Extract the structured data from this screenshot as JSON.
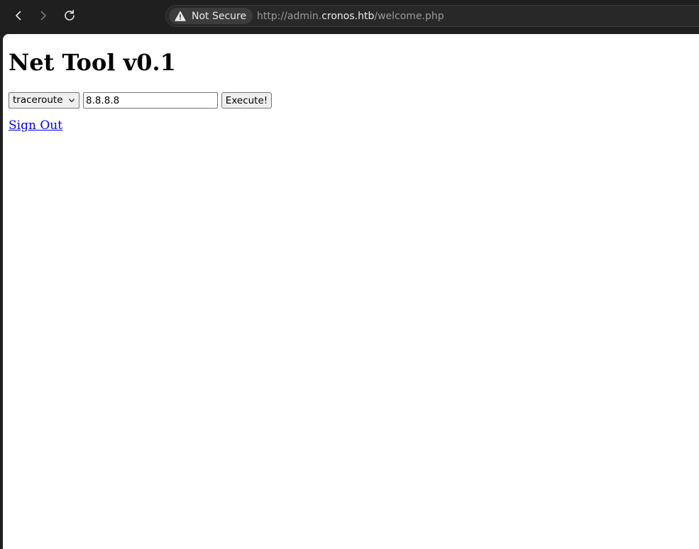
{
  "browser": {
    "security_label": "Not Secure",
    "url": {
      "scheme_and_sub": "http://admin.",
      "host": "cronos.htb",
      "path": "/welcome.php"
    },
    "icons": {
      "back": "chevron-left-icon",
      "forward": "chevron-right-icon",
      "reload": "reload-icon",
      "security": "warning-icon"
    }
  },
  "page": {
    "title": "Net Tool v0.1",
    "form": {
      "command_selected": "traceroute",
      "host_value": "8.8.8.8",
      "execute_label": "Execute!"
    },
    "signout_label": "Sign Out",
    "colors": {
      "link": "#0000ee",
      "background": "#ffffff"
    }
  }
}
